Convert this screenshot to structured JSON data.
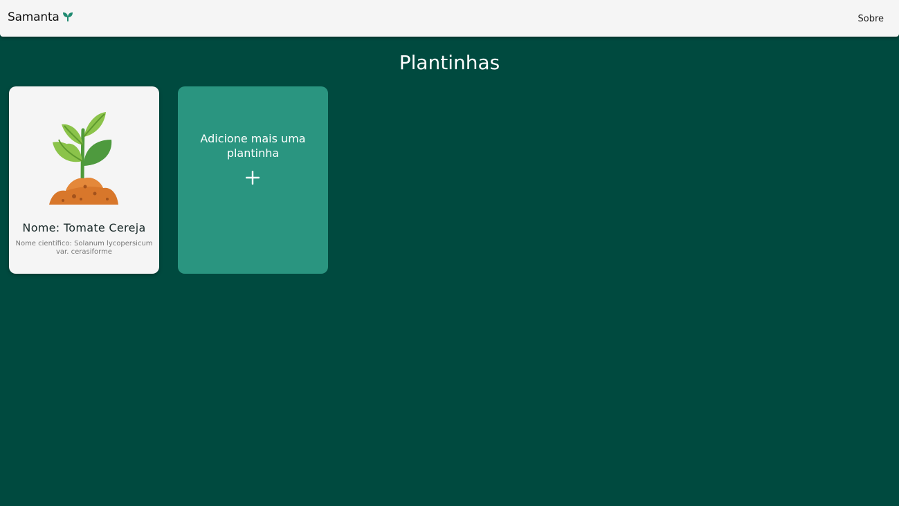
{
  "header": {
    "brand": "Samanta",
    "brand_icon": "sprout-icon",
    "nav_about": "Sobre"
  },
  "main": {
    "title": "Plantinhas",
    "plants": [
      {
        "name_label": "Nome: Tomate Cereja",
        "scientific_label": "Nome científico: Solanum lycopersicum var. cerasiforme",
        "icon": "plant-in-soil-icon"
      }
    ],
    "add_card": {
      "label": "Adicione mais uma plantinha",
      "icon": "plus-icon"
    }
  },
  "colors": {
    "background": "#004a3f",
    "header": "#f5f5f5",
    "add_card": "#2a9580",
    "accent": "#1f8a70"
  }
}
